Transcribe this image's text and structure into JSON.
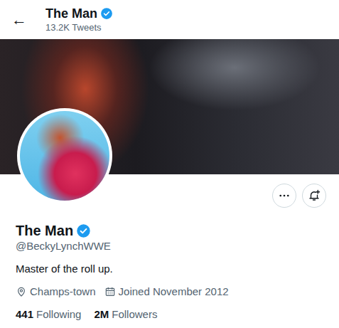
{
  "header": {
    "back_icon": "←",
    "name": "The Man",
    "verified": true,
    "tweet_count": "13.2K Tweets"
  },
  "profile": {
    "name": "The Man",
    "verified": true,
    "handle": "@BeckyLynchWWE",
    "bio": "Master of the roll up.",
    "location": "Champs-town",
    "joined": "Joined November 2012"
  },
  "stats": [
    {
      "count": "441",
      "label": "Following"
    },
    {
      "count": "2M",
      "label": "Followers"
    }
  ]
}
